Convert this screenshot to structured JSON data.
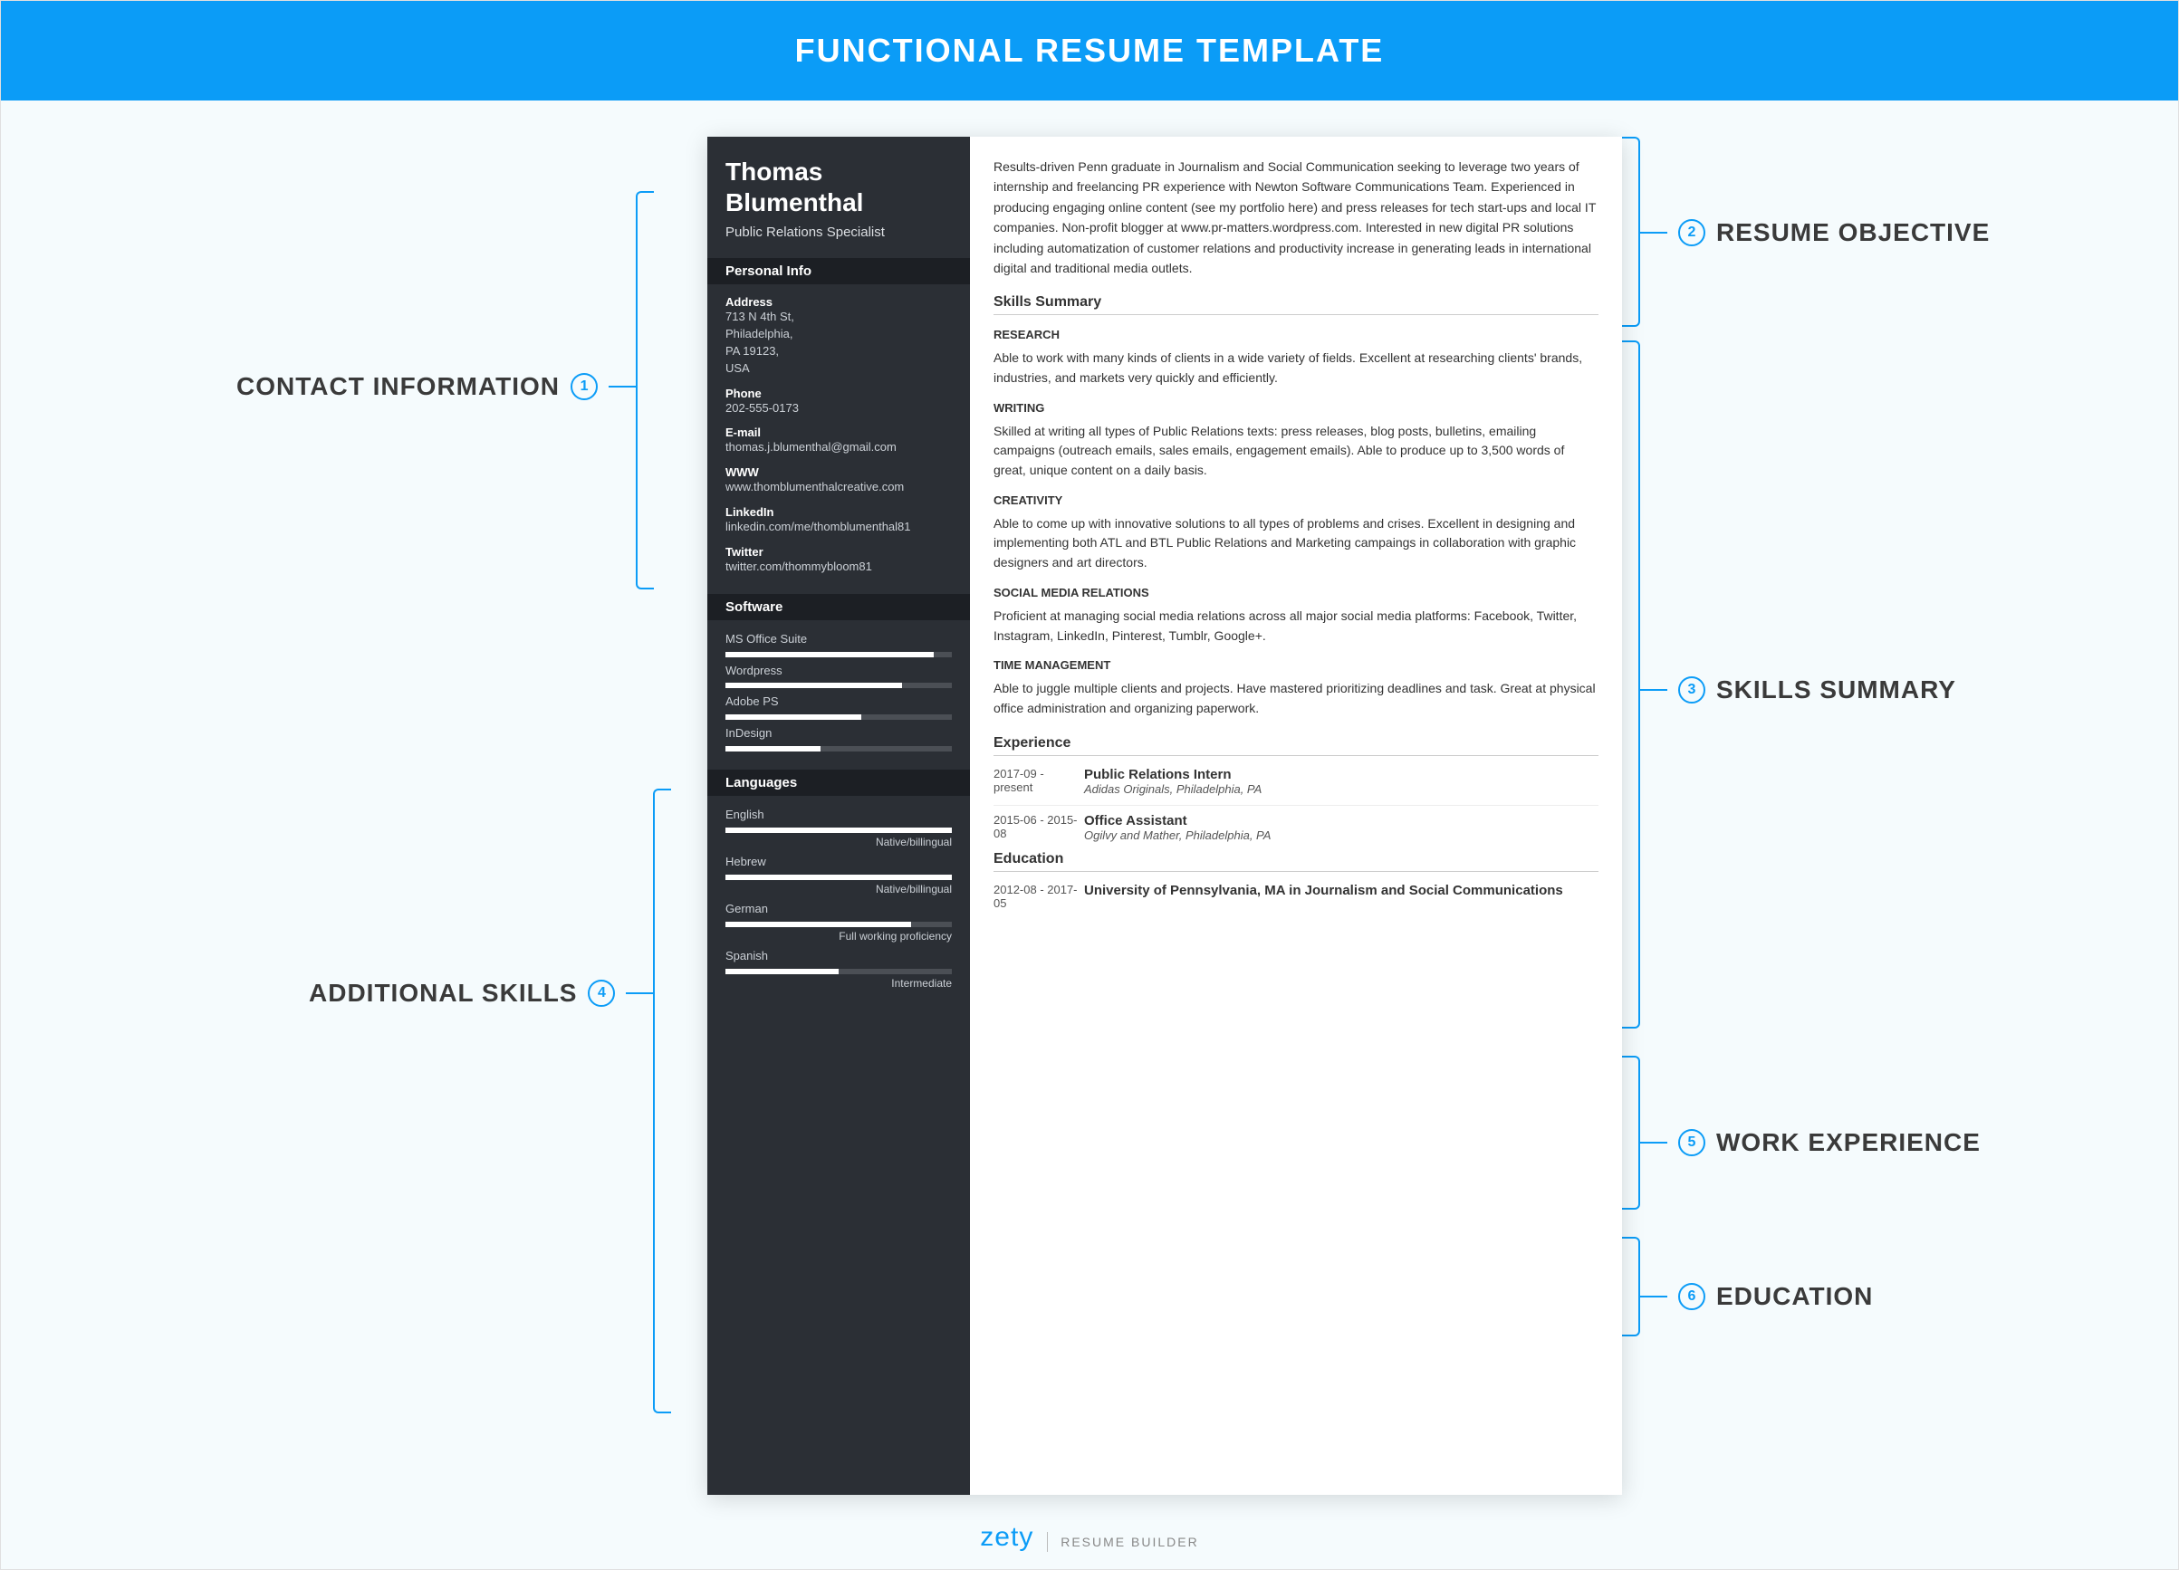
{
  "banner_title": "FUNCTIONAL RESUME TEMPLATE",
  "callouts": {
    "contact": {
      "num": "1",
      "label": "CONTACT INFORMATION"
    },
    "skills_extra": {
      "num": "4",
      "label": "ADDITIONAL SKILLS"
    },
    "objective": {
      "num": "2",
      "label": "RESUME OBJECTIVE"
    },
    "skills_summary": {
      "num": "3",
      "label": "SKILLS SUMMARY"
    },
    "work": {
      "num": "5",
      "label": "WORK EXPERIENCE"
    },
    "education": {
      "num": "6",
      "label": "EDUCATION"
    }
  },
  "sidebar": {
    "name_first": "Thomas",
    "name_last": "Blumenthal",
    "title": "Public Relations Specialist",
    "sections": {
      "personal": "Personal Info",
      "software": "Software",
      "languages": "Languages"
    },
    "info": {
      "address_label": "Address",
      "address_val": "713 N 4th St,\nPhiladelphia,\nPA 19123,\nUSA",
      "phone_label": "Phone",
      "phone_val": "202-555-0173",
      "email_label": "E-mail",
      "email_val": "thomas.j.blumenthal@gmail.com",
      "www_label": "WWW",
      "www_val": "www.thomblumenthalcreative.com",
      "linkedin_label": "LinkedIn",
      "linkedin_val": "linkedin.com/me/thomblumenthal81",
      "twitter_label": "Twitter",
      "twitter_val": "twitter.com/thommybloom81"
    },
    "software": [
      {
        "name": "MS Office Suite",
        "pct": 92
      },
      {
        "name": "Wordpress",
        "pct": 78
      },
      {
        "name": "Adobe PS",
        "pct": 60
      },
      {
        "name": "InDesign",
        "pct": 42
      }
    ],
    "languages": [
      {
        "name": "English",
        "level": "Native/billingual",
        "pct": 100
      },
      {
        "name": "Hebrew",
        "level": "Native/billingual",
        "pct": 100
      },
      {
        "name": "German",
        "level": "Full working proficiency",
        "pct": 82
      },
      {
        "name": "Spanish",
        "level": "Intermediate",
        "pct": 50
      }
    ]
  },
  "content": {
    "objective": "Results-driven Penn graduate in Journalism and Social Communication seeking to leverage two years of internship and freelancing PR experience with Newton Software Communications Team. Experienced in producing engaging online content (see my portfolio here) and press releases for tech start-ups and local IT companies. Non-profit blogger at www.pr-matters.wordpress.com. Interested in new digital PR solutions including automatization of customer relations and productivity increase in generating leads in international digital and traditional media outlets.",
    "skills_head": "Skills Summary",
    "skills": [
      {
        "cat": "RESEARCH",
        "txt": "Able to work with many kinds of clients in a wide variety of fields. Excellent at researching clients' brands, industries, and markets very quickly and efficiently."
      },
      {
        "cat": "WRITING",
        "txt": "Skilled at writing all types of Public Relations texts: press releases, blog posts, bulletins, emailing campaigns (outreach emails, sales emails, engagement emails). Able to produce up to 3,500 words of great, unique content on a daily basis."
      },
      {
        "cat": "CREATIVITY",
        "txt": "Able to come up with innovative solutions to all types of problems and crises. Excellent in designing and implementing both ATL and BTL Public Relations and Marketing campaings in collaboration with graphic designers and art directors."
      },
      {
        "cat": "SOCIAL MEDIA RELATIONS",
        "txt": "Proficient at managing social media relations across all major social media platforms: Facebook, Twitter, Instagram, LinkedIn, Pinterest, Tumblr, Google+."
      },
      {
        "cat": "TIME MANAGEMENT",
        "txt": "Able to juggle multiple clients and projects. Have mastered prioritizing deadlines and task. Great at physical office administration and organizing paperwork."
      }
    ],
    "exp_head": "Experience",
    "exp": [
      {
        "date": "2017-09 - present",
        "title": "Public Relations Intern",
        "org": "Adidas Originals, Philadelphia, PA"
      },
      {
        "date": "2015-06 - 2015-08",
        "title": "Office Assistant",
        "org": "Ogilvy and Mather, Philadelphia, PA"
      }
    ],
    "edu_head": "Education",
    "edu": [
      {
        "date": "2012-08 - 2017-05",
        "title": "University of Pennsylvania, MA in Journalism and Social Communications"
      }
    ]
  },
  "footer": {
    "logo": "zety",
    "sub": "RESUME BUILDER"
  }
}
